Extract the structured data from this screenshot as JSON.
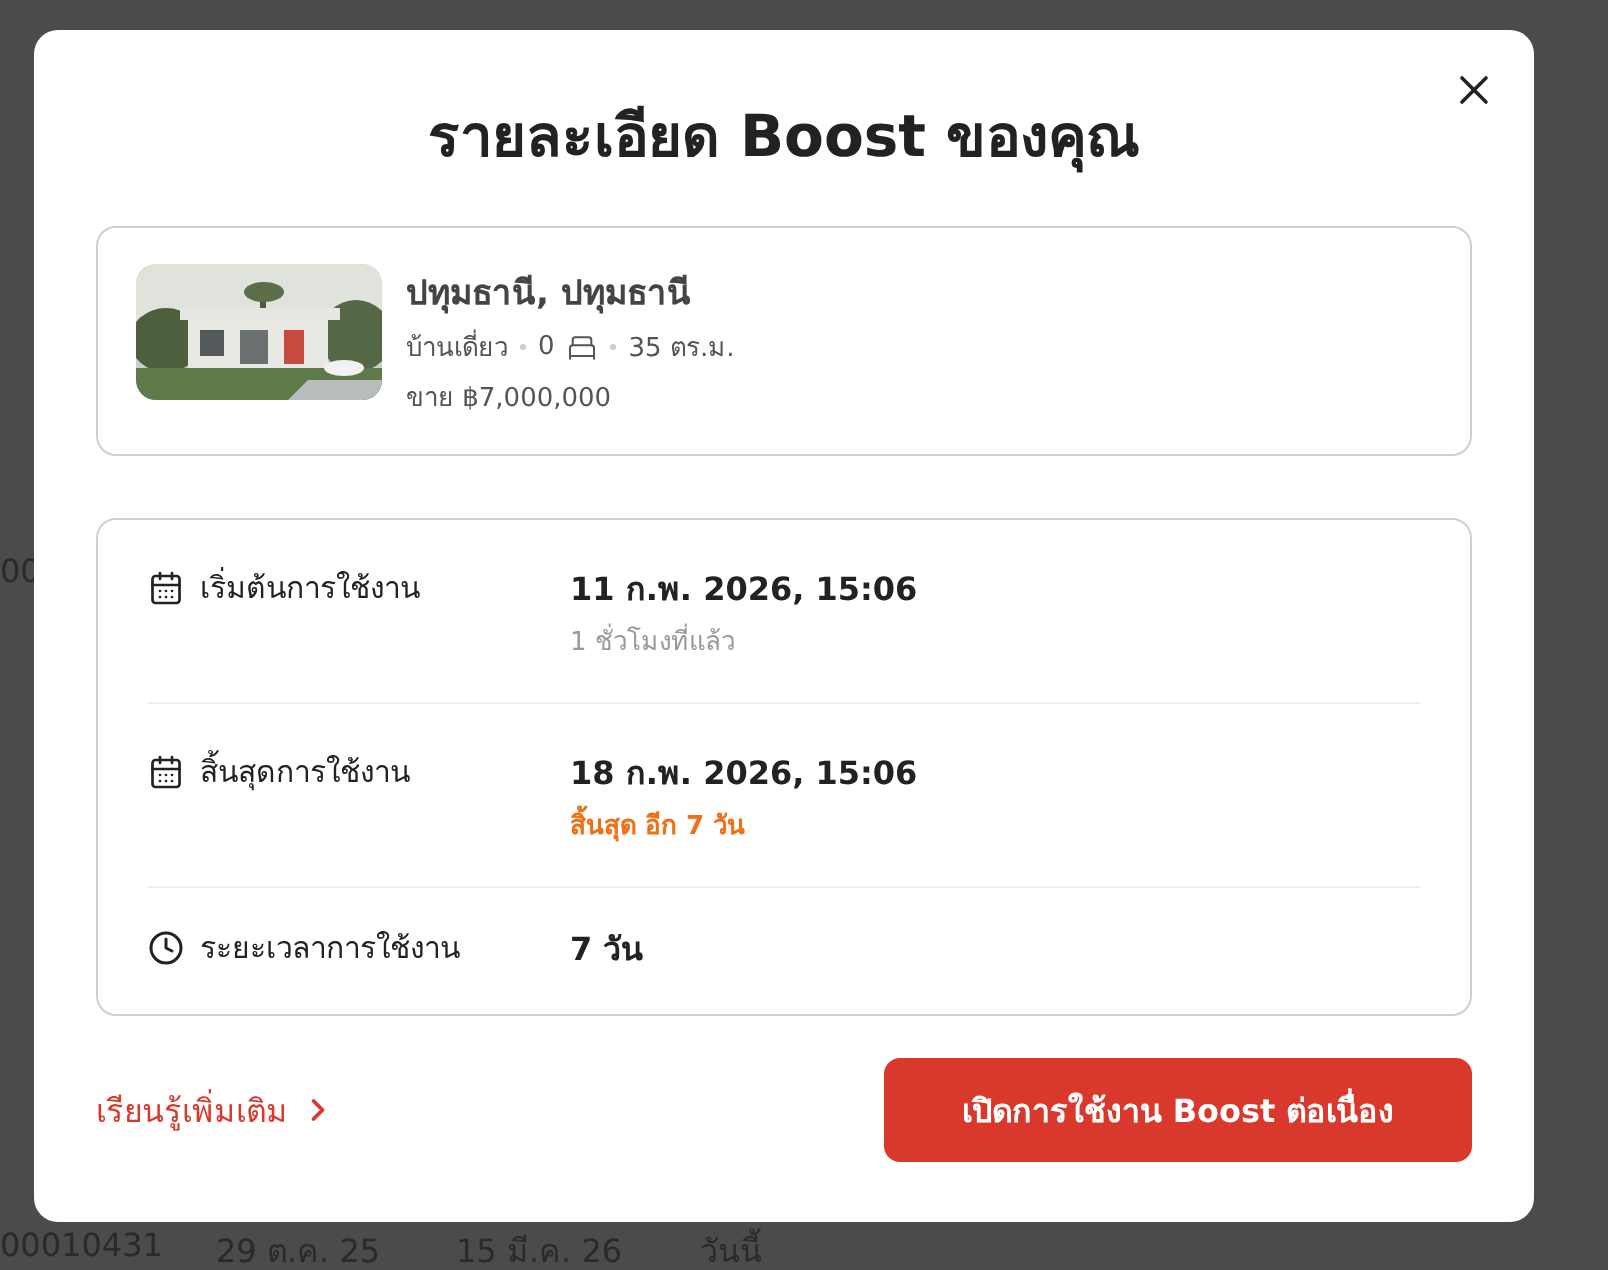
{
  "background": {
    "fragments": [
      "00"
    ],
    "bottom_row": [
      "00010431",
      "29 ต.ค. 25",
      "15 มี.ค. 26",
      "วันนี้"
    ]
  },
  "dialog": {
    "title": "รายละเอียด Boost ของคุณ",
    "property": {
      "kind": "picture",
      "location": "ปทุมธานี, ปทุมธานี",
      "type": "บ้านเดี่ยว",
      "bedrooms": "0",
      "area": "35 ตร.ม.",
      "price": "ขาย ฿7,000,000"
    },
    "rows": [
      {
        "kind": "date",
        "label": "เริ่มต้นการใช้งาน",
        "value": "11 ก.พ. 2026, 15:06",
        "note": "1 ชั่วโมงที่แล้ว",
        "warning": false
      },
      {
        "kind": "date",
        "label": "สิ้นสุดการใช้งาน",
        "value": "18 ก.พ. 2026, 15:06",
        "note": "สิ้นสุด อีก 7 วัน",
        "warning": true
      },
      {
        "kind": "duration",
        "label": "ระยะเวลาการใช้งาน",
        "value": "7 วัน"
      }
    ],
    "link": "เรียนรู้เพิ่มเติม",
    "button": "เปิดการใช้งาน Boost ต่อเนื่อง"
  }
}
